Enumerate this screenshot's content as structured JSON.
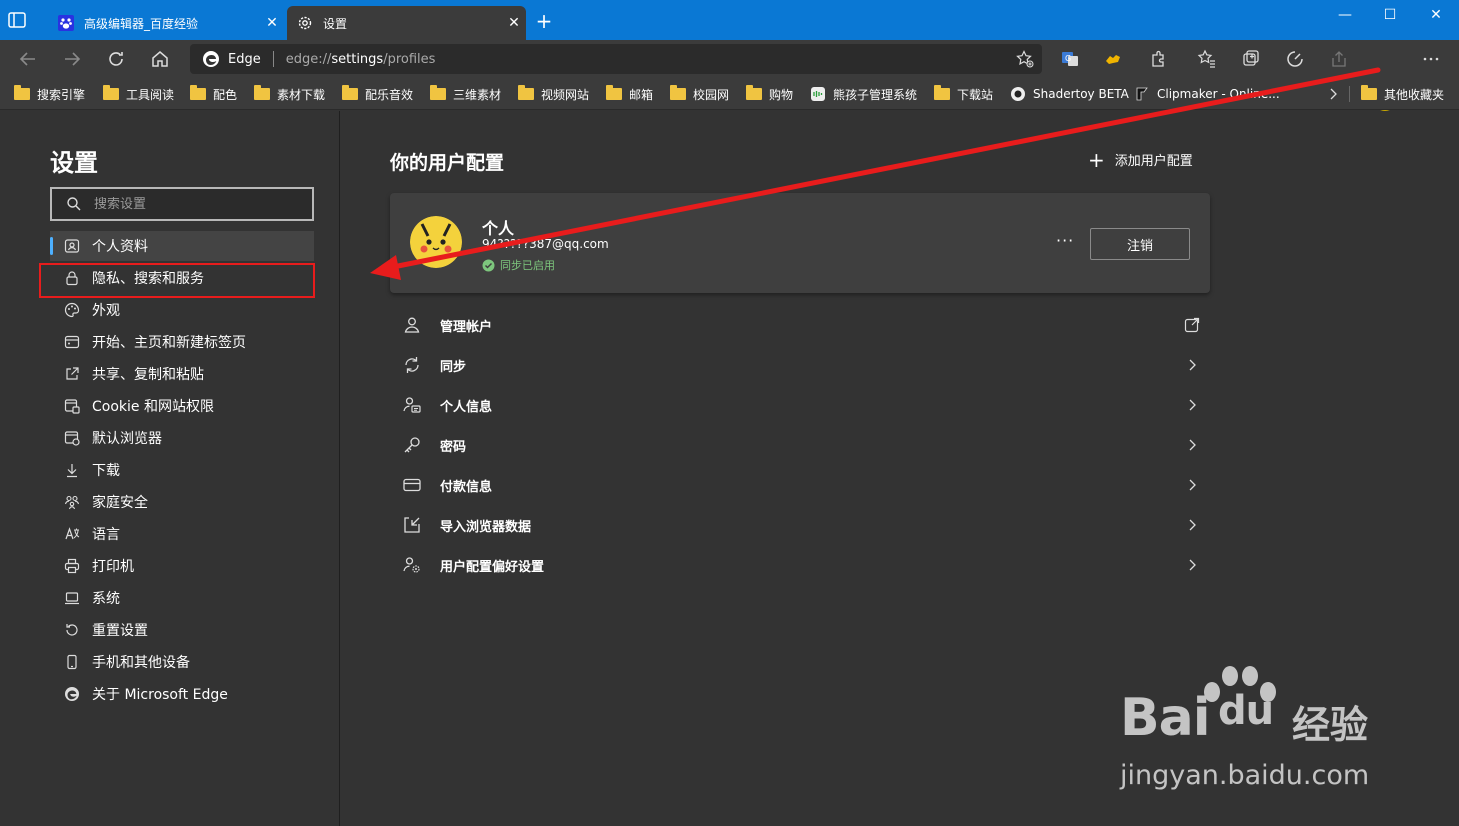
{
  "tabs": [
    {
      "title": "高级编辑器_百度经验",
      "icon": "baidu-paw-icon"
    },
    {
      "title": "设置",
      "icon": "gear-icon"
    }
  ],
  "address": {
    "site_label": "Edge",
    "url_scheme": "edge://",
    "url_host": "settings",
    "url_path": "/profiles"
  },
  "bookmarks": [
    {
      "label": "搜索引擎",
      "icon": "folder"
    },
    {
      "label": "工具阅读",
      "icon": "folder"
    },
    {
      "label": "配色",
      "icon": "folder"
    },
    {
      "label": "素材下载",
      "icon": "folder"
    },
    {
      "label": "配乐音效",
      "icon": "folder"
    },
    {
      "label": "三维素材",
      "icon": "folder"
    },
    {
      "label": "视频网站",
      "icon": "folder"
    },
    {
      "label": "邮箱",
      "icon": "folder"
    },
    {
      "label": "校园网",
      "icon": "folder"
    },
    {
      "label": "购物",
      "icon": "folder"
    },
    {
      "label": "熊孩子管理系统",
      "icon": "app"
    },
    {
      "label": "下载站",
      "icon": "folder"
    },
    {
      "label": "Shadertoy BETA",
      "icon": "shadertoy"
    },
    {
      "label": "Clipmaker - Online...",
      "icon": "clipmaker"
    },
    {
      "label": "其他收藏夹",
      "icon": "folder"
    }
  ],
  "sidebar": {
    "title": "设置",
    "search_placeholder": "搜索设置",
    "items": [
      {
        "label": "个人资料",
        "icon": "profile-icon"
      },
      {
        "label": "隐私、搜索和服务",
        "icon": "lock-icon"
      },
      {
        "label": "外观",
        "icon": "palette-icon"
      },
      {
        "label": "开始、主页和新建标签页",
        "icon": "power-icon"
      },
      {
        "label": "共享、复制和粘贴",
        "icon": "share-icon"
      },
      {
        "label": "Cookie 和网站权限",
        "icon": "cookie-icon"
      },
      {
        "label": "默认浏览器",
        "icon": "browser-icon"
      },
      {
        "label": "下载",
        "icon": "download-icon"
      },
      {
        "label": "家庭安全",
        "icon": "family-icon"
      },
      {
        "label": "语言",
        "icon": "language-icon"
      },
      {
        "label": "打印机",
        "icon": "printer-icon"
      },
      {
        "label": "系统",
        "icon": "system-icon"
      },
      {
        "label": "重置设置",
        "icon": "reset-icon"
      },
      {
        "label": "手机和其他设备",
        "icon": "phone-icon"
      },
      {
        "label": "关于 Microsoft Edge",
        "icon": "edge-icon"
      }
    ]
  },
  "main": {
    "title": "你的用户配置",
    "add_profile": "添加用户配置",
    "profile": {
      "name": "个人",
      "email": "94?????387@qq.com",
      "sync_status": "同步已启用",
      "more": "···",
      "logout": "注销"
    },
    "rows": [
      {
        "label": "管理帐户",
        "icon": "person-icon",
        "action": "external-link"
      },
      {
        "label": "同步",
        "icon": "sync-icon",
        "action": "chevron"
      },
      {
        "label": "个人信息",
        "icon": "id-card-icon",
        "action": "chevron"
      },
      {
        "label": "密码",
        "icon": "key-icon",
        "action": "chevron"
      },
      {
        "label": "付款信息",
        "icon": "card-icon",
        "action": "chevron"
      },
      {
        "label": "导入浏览器数据",
        "icon": "import-icon",
        "action": "chevron"
      },
      {
        "label": "用户配置偏好设置",
        "icon": "people-settings-icon",
        "action": "chevron"
      }
    ]
  },
  "watermark": {
    "brand": "Bai",
    "brand2": "du",
    "cn": "经验",
    "url": "jingyan.baidu.com"
  },
  "colors": {
    "titlebar": "#0a78d4",
    "accent": "#4db0ff",
    "annotation": "#e81c1c",
    "sync": "#7dc67d"
  }
}
